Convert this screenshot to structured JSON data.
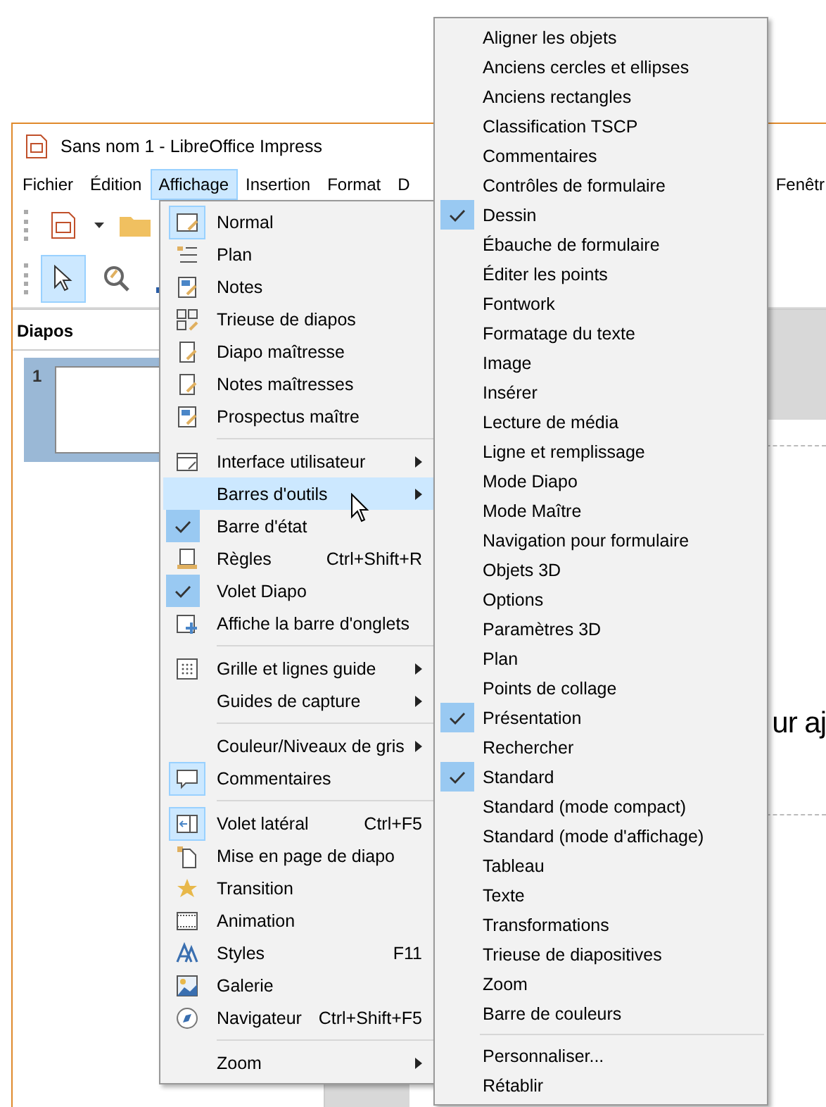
{
  "window": {
    "title": "Sans nom 1 - LibreOffice Impress"
  },
  "menu_bar": [
    {
      "label": "Fichier",
      "selected": false
    },
    {
      "label": "Édition",
      "selected": false
    },
    {
      "label": "Affichage",
      "selected": true
    },
    {
      "label": "Insertion",
      "selected": false
    },
    {
      "label": "Format",
      "selected": false
    },
    {
      "label": "D",
      "selected": false
    },
    {
      "label": "Fenêtr",
      "selected": false
    }
  ],
  "slides_panel": {
    "title": "Diapos",
    "slides": [
      {
        "number": "1",
        "selected": true
      }
    ]
  },
  "slide": {
    "title_fragment": "ur aj"
  },
  "view_menu": {
    "groups": [
      [
        {
          "label": "Normal",
          "submenu": false,
          "checked": true,
          "selected": false
        },
        {
          "label": "Plan",
          "submenu": false,
          "checked": false,
          "selected": false
        },
        {
          "label": "Notes",
          "submenu": false,
          "checked": false,
          "selected": false
        },
        {
          "label": "Trieuse de diapos",
          "submenu": false,
          "checked": false,
          "selected": false
        },
        {
          "label": "Diapo maîtresse",
          "submenu": false,
          "checked": false,
          "selected": false
        },
        {
          "label": "Notes maîtresses",
          "submenu": false,
          "checked": false,
          "selected": false
        },
        {
          "label": "Prospectus maître",
          "submenu": false,
          "checked": false,
          "selected": false
        }
      ],
      [
        {
          "label": "Interface utilisateur",
          "submenu": true,
          "checked": false,
          "selected": false
        },
        {
          "label": "Barres d'outils",
          "submenu": true,
          "checked": false,
          "selected": true
        },
        {
          "label": "Barre d'état",
          "submenu": false,
          "checked": true,
          "selected": false
        },
        {
          "label": "Règles",
          "shortcut": "Ctrl+Shift+R",
          "submenu": false,
          "checked": false,
          "selected": false
        },
        {
          "label": "Volet Diapo",
          "submenu": false,
          "checked": true,
          "selected": false
        },
        {
          "label": "Affiche la barre d'onglets",
          "submenu": false,
          "checked": false,
          "selected": false
        }
      ],
      [
        {
          "label": "Grille et lignes guide",
          "submenu": true,
          "checked": false,
          "selected": false
        },
        {
          "label": "Guides de capture",
          "submenu": true,
          "checked": false,
          "selected": false
        }
      ],
      [
        {
          "label": "Couleur/Niveaux de gris",
          "submenu": true,
          "checked": false,
          "selected": false
        },
        {
          "label": "Commentaires",
          "submenu": false,
          "checked": true,
          "selected": false
        }
      ],
      [
        {
          "label": "Volet latéral",
          "shortcut": "Ctrl+F5",
          "submenu": false,
          "checked": true,
          "selected": false
        },
        {
          "label": "Mise en page de diapo",
          "submenu": false,
          "checked": false,
          "selected": false
        },
        {
          "label": "Transition",
          "submenu": false,
          "checked": false,
          "selected": false
        },
        {
          "label": "Animation",
          "submenu": false,
          "checked": false,
          "selected": false
        },
        {
          "label": "Styles",
          "shortcut": "F11",
          "submenu": false,
          "checked": false,
          "selected": false
        },
        {
          "label": "Galerie",
          "submenu": false,
          "checked": false,
          "selected": false
        },
        {
          "label": "Navigateur",
          "shortcut": "Ctrl+Shift+F5",
          "submenu": false,
          "checked": false,
          "selected": false
        }
      ],
      [
        {
          "label": "Zoom",
          "submenu": true,
          "checked": false,
          "selected": false
        }
      ]
    ]
  },
  "toolbars_menu": {
    "groups": [
      [
        {
          "label": "Aligner les objets",
          "checked": false
        },
        {
          "label": "Anciens cercles et ellipses",
          "checked": false
        },
        {
          "label": "Anciens rectangles",
          "checked": false
        },
        {
          "label": "Classification TSCP",
          "checked": false
        },
        {
          "label": "Commentaires",
          "checked": false
        },
        {
          "label": "Contrôles de formulaire",
          "checked": false
        },
        {
          "label": "Dessin",
          "checked": true
        },
        {
          "label": "Ébauche de formulaire",
          "checked": false
        },
        {
          "label": "Éditer les points",
          "checked": false
        },
        {
          "label": "Fontwork",
          "checked": false
        },
        {
          "label": "Formatage du texte",
          "checked": false
        },
        {
          "label": "Image",
          "checked": false
        },
        {
          "label": "Insérer",
          "checked": false
        },
        {
          "label": "Lecture de média",
          "checked": false
        },
        {
          "label": "Ligne et remplissage",
          "checked": false
        },
        {
          "label": "Mode Diapo",
          "checked": false
        },
        {
          "label": "Mode Maître",
          "checked": false
        },
        {
          "label": "Navigation pour formulaire",
          "checked": false
        },
        {
          "label": "Objets 3D",
          "checked": false
        },
        {
          "label": "Options",
          "checked": false
        },
        {
          "label": "Paramètres 3D",
          "checked": false
        },
        {
          "label": "Plan",
          "checked": false
        },
        {
          "label": "Points de collage",
          "checked": false
        },
        {
          "label": "Présentation",
          "checked": true
        },
        {
          "label": "Rechercher",
          "checked": false
        },
        {
          "label": "Standard",
          "checked": true
        },
        {
          "label": "Standard (mode compact)",
          "checked": false
        },
        {
          "label": "Standard (mode d'affichage)",
          "checked": false
        },
        {
          "label": "Tableau",
          "checked": false
        },
        {
          "label": "Texte",
          "checked": false
        },
        {
          "label": "Transformations",
          "checked": false
        },
        {
          "label": "Trieuse de diapositives",
          "checked": false
        },
        {
          "label": "Zoom",
          "checked": false
        },
        {
          "label": "Barre de couleurs",
          "checked": false
        }
      ],
      [
        {
          "label": "Personnaliser...",
          "checked": false
        },
        {
          "label": "Rétablir",
          "checked": false
        }
      ]
    ]
  }
}
